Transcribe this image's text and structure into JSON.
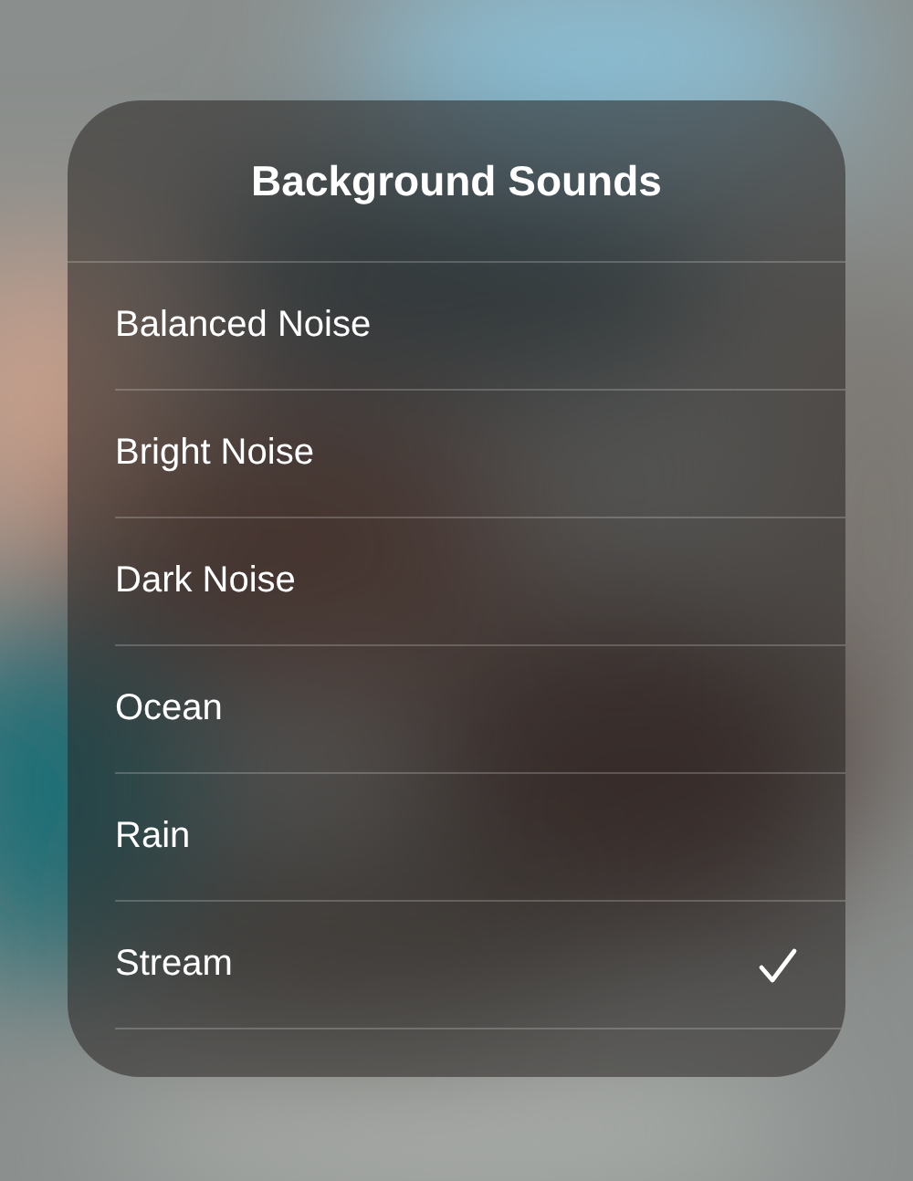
{
  "title": "Background Sounds",
  "items": [
    {
      "label": "Balanced Noise",
      "selected": false
    },
    {
      "label": "Bright Noise",
      "selected": false
    },
    {
      "label": "Dark Noise",
      "selected": false
    },
    {
      "label": "Ocean",
      "selected": false
    },
    {
      "label": "Rain",
      "selected": false
    },
    {
      "label": "Stream",
      "selected": true
    }
  ]
}
